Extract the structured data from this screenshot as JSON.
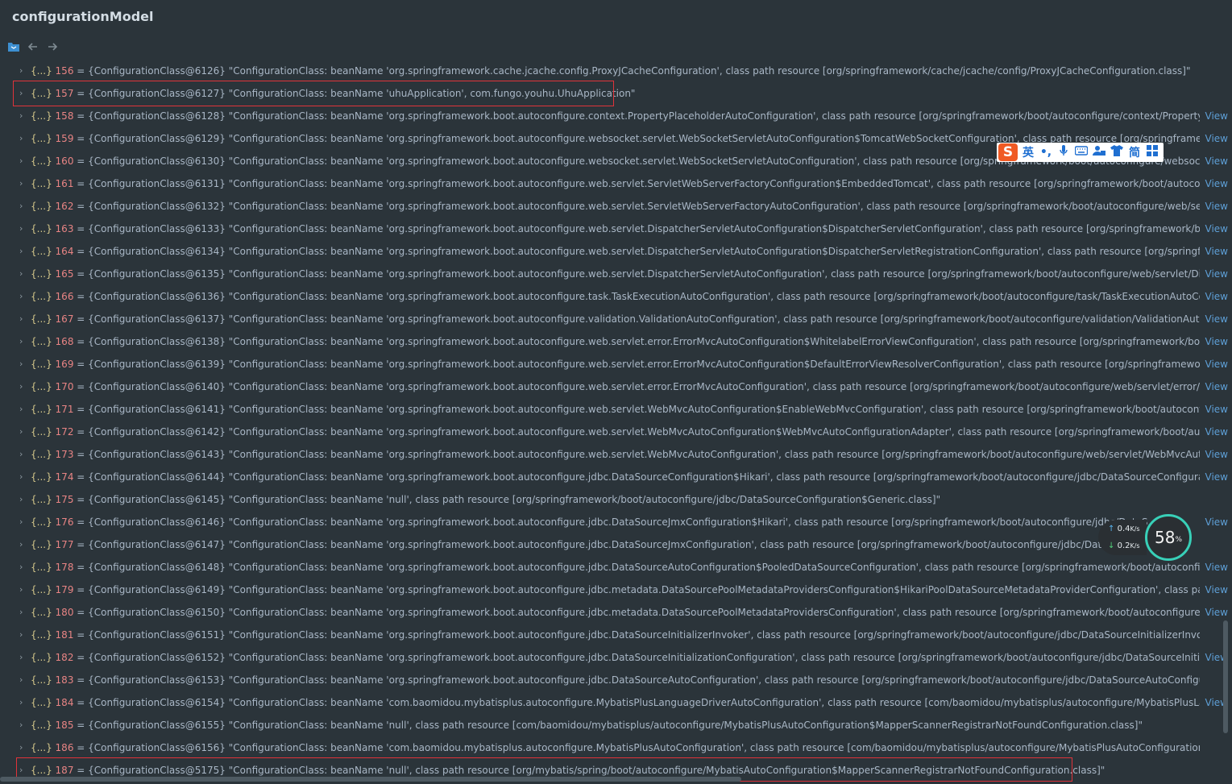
{
  "window": {
    "title": "configurationModel"
  },
  "toolbar": {
    "icons": [
      "folder-blue-icon",
      "back-arrow-icon",
      "forward-arrow-icon"
    ]
  },
  "rows": [
    {
      "idx": "156",
      "obj": "{ConfigurationClass@6126}",
      "text": "\"ConfigurationClass: beanName 'org.springframework.cache.jcache.config.ProxyJCacheConfiguration', class path resource [org/springframework/cache/jcache/config/ProxyJCacheConfiguration.class]\"",
      "view": ""
    },
    {
      "idx": "157",
      "obj": "{ConfigurationClass@6127}",
      "text": "\"ConfigurationClass: beanName 'uhuApplication', com.fungo.youhu.UhuApplication\"",
      "view": ""
    },
    {
      "idx": "158",
      "obj": "{ConfigurationClass@6128}",
      "text": "\"ConfigurationClass: beanName 'org.springframework.boot.autoconfigure.context.PropertyPlaceholderAutoConfiguration', class path resource [org/springframework/boot/autoconfigure/context/PropertyPlaceho...",
      "view": "View"
    },
    {
      "idx": "159",
      "obj": "{ConfigurationClass@6129}",
      "text": "\"ConfigurationClass: beanName 'org.springframework.boot.autoconfigure.websocket.servlet.WebSocketServletAutoConfiguration$TomcatWebSocketConfiguration', class path resource [org/springframework/bo...",
      "view": "View"
    },
    {
      "idx": "160",
      "obj": "{ConfigurationClass@6130}",
      "text": "\"ConfigurationClass: beanName 'org.springframework.boot.autoconfigure.websocket.servlet.WebSocketServletAutoConfiguration', class path resource [org/springframework/boot/autoconfigure/websocket/servl...",
      "view": "View"
    },
    {
      "idx": "161",
      "obj": "{ConfigurationClass@6131}",
      "text": "\"ConfigurationClass: beanName 'org.springframework.boot.autoconfigure.web.servlet.ServletWebServerFactoryConfiguration$EmbeddedTomcat', class path resource [org/springframework/boot/autoconfigure/v...",
      "view": "View"
    },
    {
      "idx": "162",
      "obj": "{ConfigurationClass@6132}",
      "text": "\"ConfigurationClass: beanName 'org.springframework.boot.autoconfigure.web.servlet.ServletWebServerFactoryAutoConfiguration', class path resource [org/springframework/boot/autoconfigure/web/servlet/Ser...",
      "view": "View"
    },
    {
      "idx": "163",
      "obj": "{ConfigurationClass@6133}",
      "text": "\"ConfigurationClass: beanName 'org.springframework.boot.autoconfigure.web.servlet.DispatcherServletAutoConfiguration$DispatcherServletConfiguration', class path resource [org/springframework/boot/autoc...",
      "view": "View"
    },
    {
      "idx": "164",
      "obj": "{ConfigurationClass@6134}",
      "text": "\"ConfigurationClass: beanName 'org.springframework.boot.autoconfigure.web.servlet.DispatcherServletAutoConfiguration$DispatcherServletRegistrationConfiguration', class path resource [org/springframework/...",
      "view": "View"
    },
    {
      "idx": "165",
      "obj": "{ConfigurationClass@6135}",
      "text": "\"ConfigurationClass: beanName 'org.springframework.boot.autoconfigure.web.servlet.DispatcherServletAutoConfiguration', class path resource [org/springframework/boot/autoconfigure/web/servlet/Dispatcher...",
      "view": "View"
    },
    {
      "idx": "166",
      "obj": "{ConfigurationClass@6136}",
      "text": "\"ConfigurationClass: beanName 'org.springframework.boot.autoconfigure.task.TaskExecutionAutoConfiguration', class path resource [org/springframework/boot/autoconfigure/task/TaskExecutionAutoConfigura...",
      "view": "View"
    },
    {
      "idx": "167",
      "obj": "{ConfigurationClass@6137}",
      "text": "\"ConfigurationClass: beanName 'org.springframework.boot.autoconfigure.validation.ValidationAutoConfiguration', class path resource [org/springframework/boot/autoconfigure/validation/ValidationAutoConfigu...",
      "view": "View"
    },
    {
      "idx": "168",
      "obj": "{ConfigurationClass@6138}",
      "text": "\"ConfigurationClass: beanName 'org.springframework.boot.autoconfigure.web.servlet.error.ErrorMvcAutoConfiguration$WhitelabelErrorViewConfiguration', class path resource [org/springframework/boot/autoc...",
      "view": "View"
    },
    {
      "idx": "169",
      "obj": "{ConfigurationClass@6139}",
      "text": "\"ConfigurationClass: beanName 'org.springframework.boot.autoconfigure.web.servlet.error.ErrorMvcAutoConfiguration$DefaultErrorViewResolverConfiguration', class path resource [org/springframework/boot/...",
      "view": "View"
    },
    {
      "idx": "170",
      "obj": "{ConfigurationClass@6140}",
      "text": "\"ConfigurationClass: beanName 'org.springframework.boot.autoconfigure.web.servlet.error.ErrorMvcAutoConfiguration', class path resource [org/springframework/boot/autoconfigure/web/servlet/error/ErrorM...",
      "view": "View"
    },
    {
      "idx": "171",
      "obj": "{ConfigurationClass@6141}",
      "text": "\"ConfigurationClass: beanName 'org.springframework.boot.autoconfigure.web.servlet.WebMvcAutoConfiguration$EnableWebMvcConfiguration', class path resource [org/springframework/boot/autoconfigure/w...",
      "view": "View"
    },
    {
      "idx": "172",
      "obj": "{ConfigurationClass@6142}",
      "text": "\"ConfigurationClass: beanName 'org.springframework.boot.autoconfigure.web.servlet.WebMvcAutoConfiguration$WebMvcAutoConfigurationAdapter', class path resource [org/springframework/boot/autoconfig...",
      "view": "View"
    },
    {
      "idx": "173",
      "obj": "{ConfigurationClass@6143}",
      "text": "\"ConfigurationClass: beanName 'org.springframework.boot.autoconfigure.web.servlet.WebMvcAutoConfiguration', class path resource [org/springframework/boot/autoconfigure/web/servlet/WebMvcAutoConfig...",
      "view": "View"
    },
    {
      "idx": "174",
      "obj": "{ConfigurationClass@6144}",
      "text": "\"ConfigurationClass: beanName 'org.springframework.boot.autoconfigure.jdbc.DataSourceConfiguration$Hikari', class path resource [org/springframework/boot/autoconfigure/jdbc/DataSourceConfiguration$Hi...",
      "view": "View"
    },
    {
      "idx": "175",
      "obj": "{ConfigurationClass@6145}",
      "text": "\"ConfigurationClass: beanName 'null', class path resource [org/springframework/boot/autoconfigure/jdbc/DataSourceConfiguration$Generic.class]\"",
      "view": ""
    },
    {
      "idx": "176",
      "obj": "{ConfigurationClass@6146}",
      "text": "\"ConfigurationClass: beanName 'org.springframework.boot.autoconfigure.jdbc.DataSourceJmxConfiguration$Hikari', class path resource [org/springframework/boot/autoconfigure/jdbc/DataS...",
      "view": "View"
    },
    {
      "idx": "177",
      "obj": "{ConfigurationClass@6147}",
      "text": "\"ConfigurationClass: beanName 'org.springframework.boot.autoconfigure.jdbc.DataSourceJmxConfiguration', class path resource [org/springframework/boot/autoconfigure/jdbc/DataSource...",
      "view": ""
    },
    {
      "idx": "178",
      "obj": "{ConfigurationClass@6148}",
      "text": "\"ConfigurationClass: beanName 'org.springframework.boot.autoconfigure.jdbc.DataSourceAutoConfiguration$PooledDataSourceConfiguration', class path resource [org/springframework/boot/autoconfigure/jdb...",
      "view": "View"
    },
    {
      "idx": "179",
      "obj": "{ConfigurationClass@6149}",
      "text": "\"ConfigurationClass: beanName 'org.springframework.boot.autoconfigure.jdbc.metadata.DataSourcePoolMetadataProvidersConfiguration$HikariPoolDataSourceMetadataProviderConfiguration', class path resou...",
      "view": "View"
    },
    {
      "idx": "180",
      "obj": "{ConfigurationClass@6150}",
      "text": "\"ConfigurationClass: beanName 'org.springframework.boot.autoconfigure.jdbc.metadata.DataSourcePoolMetadataProvidersConfiguration', class path resource [org/springframework/boot/autoconfigure/jdbc/m...",
      "view": "View"
    },
    {
      "idx": "181",
      "obj": "{ConfigurationClass@6151}",
      "text": "\"ConfigurationClass: beanName 'org.springframework.boot.autoconfigure.jdbc.DataSourceInitializerInvoker', class path resource [org/springframework/boot/autoconfigure/jdbc/DataSourceInitializerInvoker.class]\"",
      "view": ""
    },
    {
      "idx": "182",
      "obj": "{ConfigurationClass@6152}",
      "text": "\"ConfigurationClass: beanName 'org.springframework.boot.autoconfigure.jdbc.DataSourceInitializationConfiguration', class path resource [org/springframework/boot/autoconfigure/jdbc/DataSourceInitializati...",
      "view": "View"
    },
    {
      "idx": "183",
      "obj": "{ConfigurationClass@6153}",
      "text": "\"ConfigurationClass: beanName 'org.springframework.boot.autoconfigure.jdbc.DataSourceAutoConfiguration', class path resource [org/springframework/boot/autoconfigure/jdbc/DataSourceAutoConfiguration.class]\"",
      "view": ""
    },
    {
      "idx": "184",
      "obj": "{ConfigurationClass@6154}",
      "text": "\"ConfigurationClass: beanName 'com.baomidou.mybatisplus.autoconfigure.MybatisPlusLanguageDriverAutoConfiguration', class path resource [com/baomidou/mybatisplus/autoconfigure/MybatisPlusLanguageD...",
      "view": "View"
    },
    {
      "idx": "185",
      "obj": "{ConfigurationClass@6155}",
      "text": "\"ConfigurationClass: beanName 'null', class path resource [com/baomidou/mybatisplus/autoconfigure/MybatisPlusAutoConfiguration$MapperScannerRegistrarNotFoundConfiguration.class]\"",
      "view": ""
    },
    {
      "idx": "186",
      "obj": "{ConfigurationClass@6156}",
      "text": "\"ConfigurationClass: beanName 'com.baomidou.mybatisplus.autoconfigure.MybatisPlusAutoConfiguration', class path resource [com/baomidou/mybatisplus/autoconfigure/MybatisPlusAutoConfiguration.class]\"",
      "view": ""
    },
    {
      "idx": "187",
      "obj": "{ConfigurationClass@5175}",
      "text": "\"ConfigurationClass: beanName 'null', class path resource [org/mybatis/spring/boot/autoconfigure/MybatisAutoConfiguration$MapperScannerRegistrarNotFoundConfiguration.class]\"",
      "view": ""
    }
  ],
  "row_prefix": {
    "braces": "{...}",
    "eq": "="
  },
  "ime": {
    "logo": "S",
    "lang": "英",
    "punct": "•,",
    "simplified": "简"
  },
  "net": {
    "up": "0.4",
    "up_unit": "K/s",
    "down": "0.2",
    "down_unit": "K/s",
    "percent": "58",
    "percent_sign": "%"
  },
  "colors": {
    "background": "#2b343a",
    "index": "#e88484",
    "braces": "#d3c68a",
    "link": "#5e9fd6",
    "highlight_box": "#e0333a"
  }
}
